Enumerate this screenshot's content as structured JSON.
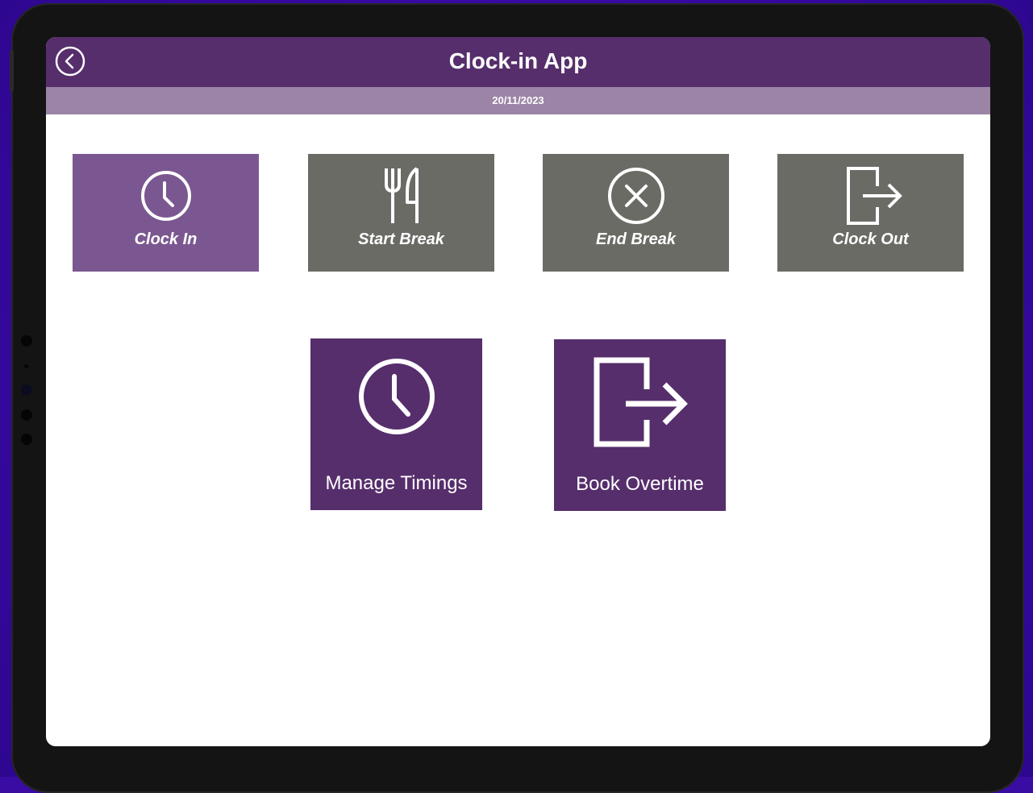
{
  "app": {
    "title": "Clock-in App",
    "date": "20/11/2023"
  },
  "actions": [
    {
      "label": "Clock In",
      "icon": "clock-icon",
      "color": "#7b5791"
    },
    {
      "label": "Start Break",
      "icon": "fork-knife-icon",
      "color": "#6b6b66"
    },
    {
      "label": "End Break",
      "icon": "cancel-circle-icon",
      "color": "#6b6b66"
    },
    {
      "label": "Clock Out",
      "icon": "exit-icon",
      "color": "#6b6b66"
    }
  ],
  "links": [
    {
      "label": "Manage Timings",
      "icon": "clock-icon"
    },
    {
      "label": "Book Overtime",
      "icon": "exit-icon"
    }
  ],
  "colors": {
    "header": "#562e6c",
    "datebar": "#9b84a6",
    "active_tile": "#7b5791",
    "inactive_tile": "#6b6b66",
    "background": "#3a0ca3"
  }
}
